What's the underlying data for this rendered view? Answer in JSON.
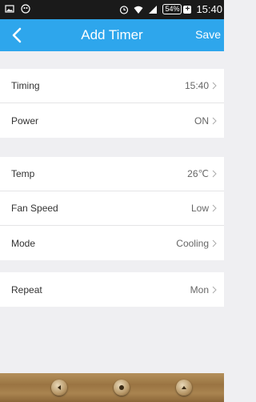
{
  "status_bar": {
    "battery": "54%",
    "time": "15:40",
    "icons": [
      "image-icon",
      "app-icon",
      "alarm-icon",
      "wifi-icon",
      "signal-icon",
      "battery-icon",
      "charging-icon"
    ]
  },
  "header": {
    "title": "Add Timer",
    "save_label": "Save",
    "back_icon": "chevron-left-icon",
    "color": "#2ea6ec"
  },
  "groups": [
    {
      "rows": [
        {
          "label": "Timing",
          "value": "15:40"
        },
        {
          "label": "Power",
          "value": "ON"
        }
      ]
    },
    {
      "rows": [
        {
          "label": "Temp",
          "value": "26℃"
        },
        {
          "label": "Fan Speed",
          "value": "Low"
        },
        {
          "label": "Mode",
          "value": "Cooling"
        }
      ]
    },
    {
      "rows": [
        {
          "label": "Repeat",
          "value": "Mon"
        }
      ]
    }
  ],
  "bottom_nav": [
    "back-nav-icon",
    "home-nav-icon",
    "menu-nav-icon"
  ]
}
